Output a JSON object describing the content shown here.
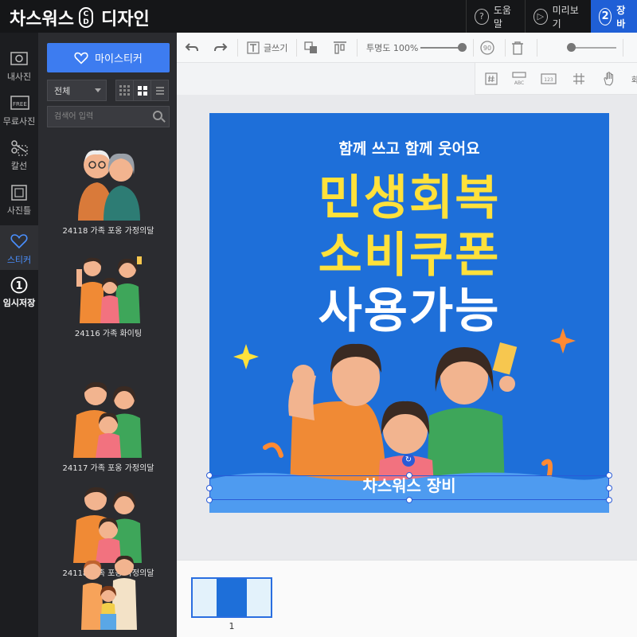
{
  "app": {
    "brand_left": "차스워스",
    "brand_logo": "C D",
    "brand_right": "디자인"
  },
  "topbar": {
    "help_num": "?",
    "help": "도움말",
    "preview_num": "▷",
    "preview": "미리보기",
    "step_num": "2",
    "step_label": "장바"
  },
  "leftnav": {
    "items": [
      {
        "icon": "photo-icon",
        "label": "내사진"
      },
      {
        "icon": "free-photo-icon",
        "label": "무료사진"
      },
      {
        "icon": "cut-icon",
        "label": "칼선"
      },
      {
        "icon": "frame-icon",
        "label": "사진틀"
      },
      {
        "icon": "heart-icon",
        "label": "스티커"
      },
      {
        "icon": "save-icon",
        "label": "임시저장",
        "num": "1"
      }
    ]
  },
  "panel": {
    "my_sticker_button": "마이스티커",
    "filter_value": "전체",
    "search_placeholder": "검색어 입력",
    "stickers": [
      {
        "label": "24118 가족 포옹 가정의달"
      },
      {
        "label": "24116 가족 화이팅"
      },
      {
        "label": "24117 가족 포옹 가정의달"
      },
      {
        "label": "24118 가족 포옹 가정의달"
      },
      {
        "label": ""
      }
    ]
  },
  "toolbar": {
    "text_tool": "글쓰기",
    "opacity_label": "투명도 100%",
    "opacity_value": 100,
    "rotate_label": "90",
    "more_label": "화"
  },
  "design": {
    "subtitle": "함께 쓰고 함께 웃어요",
    "line1": "민생회복",
    "line2": "소비쿠폰",
    "line3": "사용가능",
    "watermark": "차스워스 장비",
    "colors": {
      "background": "#1e6fd9",
      "highlight": "#ffe13b",
      "text": "#ffffff"
    }
  },
  "pages": {
    "current": "1"
  }
}
